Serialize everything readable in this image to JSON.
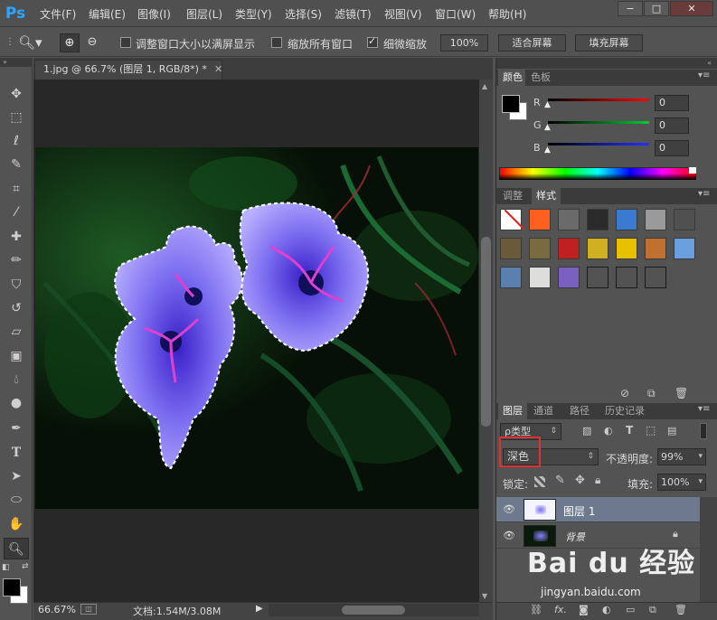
{
  "app": {
    "logo": "Ps"
  },
  "menu": [
    "文件(F)",
    "编辑(E)",
    "图像(I)",
    "图层(L)",
    "类型(Y)",
    "选择(S)",
    "滤镜(T)",
    "视图(V)",
    "窗口(W)",
    "帮助(H)"
  ],
  "window_controls": {
    "minimize": "−",
    "maximize": "□",
    "close": "✕"
  },
  "options": {
    "resize_windows": {
      "label": "调整窗口大小以满屏显示",
      "checked": false
    },
    "zoom_all": {
      "label": "缩放所有窗口",
      "checked": false
    },
    "scrubby_zoom": {
      "label": "细微缩放",
      "checked": true
    },
    "zoom_100": "100%",
    "fit_screen": "适合屏幕",
    "fill_screen": "填充屏幕"
  },
  "document": {
    "tab_title": "1.jpg @ 66.7% (图层 1, RGB/8*) *",
    "zoom": "66.67%",
    "doc_info": "文档:1.54M/3.08M"
  },
  "color_panel": {
    "tabs": [
      "颜色",
      "色板"
    ],
    "channels": [
      {
        "name": "R",
        "value": "0"
      },
      {
        "name": "G",
        "value": "0"
      },
      {
        "name": "B",
        "value": "0"
      }
    ],
    "colors": {
      "r": "#ff0000",
      "g": "#00cc33",
      "b": "#2233ff",
      "foreground": "#000000",
      "background": "#ffffff"
    }
  },
  "styles_panel": {
    "tabs": [
      "调整",
      "样式"
    ]
  },
  "layers_panel": {
    "tabs": [
      "图层",
      "通道",
      "路径",
      "历史记录"
    ],
    "filter_kind": "ρ类型",
    "blend_mode": "深色",
    "opacity_label": "不透明度:",
    "opacity_value": "99%",
    "lock_label": "锁定:",
    "fill_label": "填充:",
    "fill_value": "100%",
    "layers": [
      {
        "name": "图层 1",
        "selected": true,
        "locked": false
      },
      {
        "name": "背景",
        "selected": false,
        "locked": true
      }
    ]
  },
  "watermark": {
    "brand": "Bai du 经验",
    "url": "jingyan.baidu.com"
  }
}
